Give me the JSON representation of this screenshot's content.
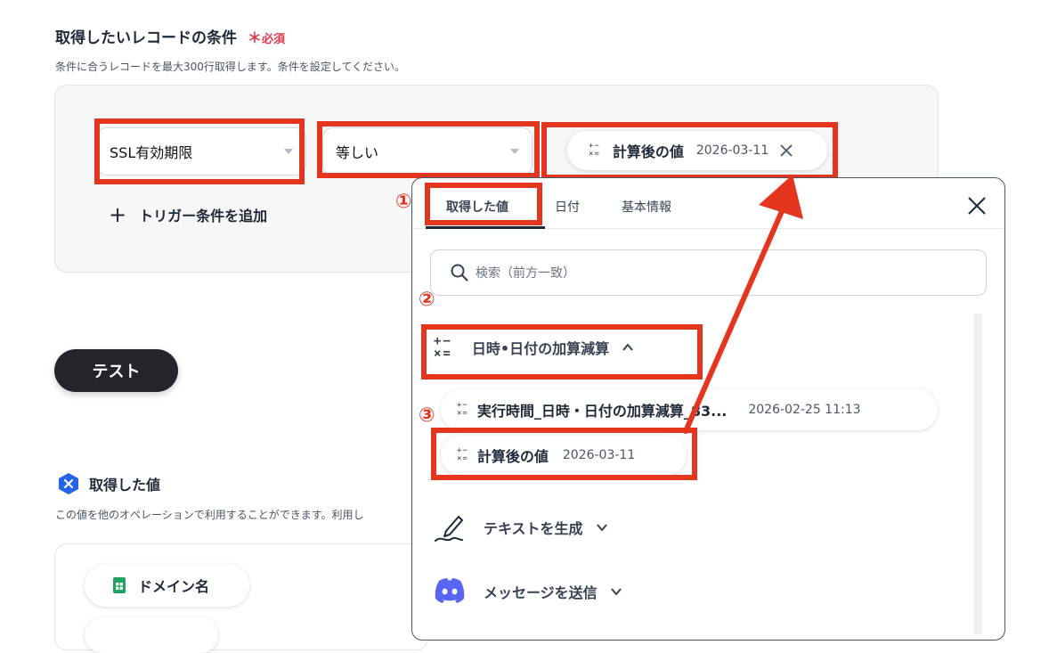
{
  "conditions": {
    "title": "取得したいレコードの条件",
    "required_mark": "＊",
    "required_label": "必須",
    "description": "条件に合うレコードを最大300行取得します。条件を設定してください。",
    "field_select": "SSL有効期限",
    "operator_select": "等しい",
    "value_chip_name": "計算後の値",
    "value_chip_value": "2026-03-11",
    "add_label": "トリガー条件を追加",
    "add_icon": "+"
  },
  "test_button": "テスト",
  "got_values": {
    "title": "取得した値",
    "description": "この値を他のオペレーションで利用することができます。利用し",
    "items": [
      "ドメイン名"
    ]
  },
  "dropdown": {
    "tabs": [
      "取得した値",
      "日付",
      "基本情報"
    ],
    "search_placeholder": "検索（前方一致）",
    "group": {
      "label": "日時•日付の加算減算",
      "items": [
        {
          "name": "実行時間_日時・日付の加算減算_83...",
          "value": "2026-02-25 11:13"
        },
        {
          "name": "計算後の値",
          "value": "2026-03-11"
        }
      ]
    },
    "collapsed_groups": [
      {
        "label": "テキストを生成",
        "icon": "pen-icon"
      },
      {
        "label": "メッセージを送信",
        "icon": "discord-icon"
      }
    ]
  },
  "annotations": {
    "step1": "①",
    "step2": "②",
    "step3": "③"
  },
  "colors": {
    "accent_red": "#e4351f",
    "required_red": "#e0384f",
    "dark_button": "#23252b",
    "discord": "#5865f2",
    "sheets_green": "#1ea362",
    "yoom_blue": "#2563eb"
  }
}
